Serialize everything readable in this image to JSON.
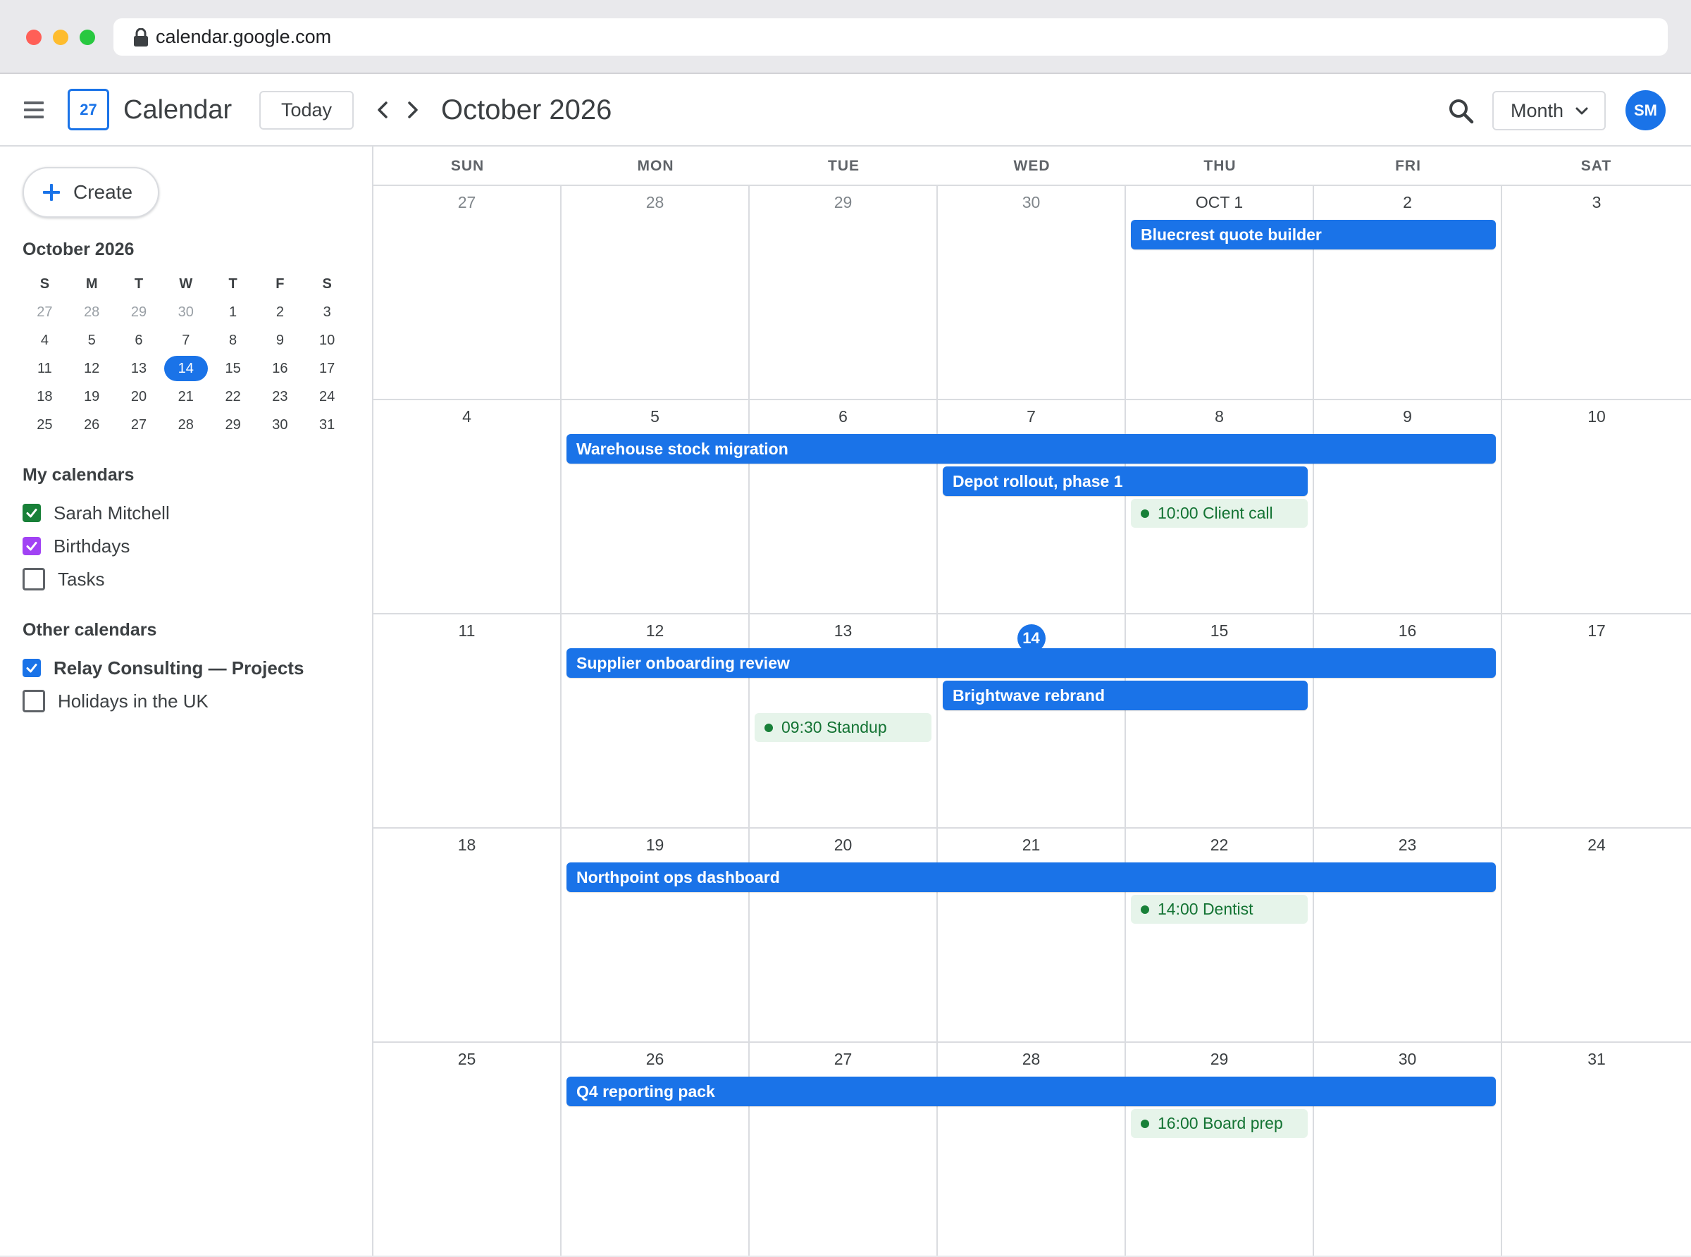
{
  "browser": {
    "url": "calendar.google.com"
  },
  "header": {
    "app_name": "Calendar",
    "logo_day": "27",
    "today_label": "Today",
    "month_title": "October 2026",
    "view_label": "Month",
    "avatar_initials": "SM"
  },
  "sidebar": {
    "create_label": "Create",
    "mini_title": "October 2026",
    "mini_weekdays": [
      "S",
      "M",
      "T",
      "W",
      "T",
      "F",
      "S"
    ],
    "mini_weeks": [
      [
        "27",
        "28",
        "29",
        "30",
        "1",
        "2",
        "3"
      ],
      [
        "4",
        "5",
        "6",
        "7",
        "8",
        "9",
        "10"
      ],
      [
        "11",
        "12",
        "13",
        "14",
        "15",
        "16",
        "17"
      ],
      [
        "18",
        "19",
        "20",
        "21",
        "22",
        "23",
        "24"
      ],
      [
        "25",
        "26",
        "27",
        "28",
        "29",
        "30",
        "31"
      ]
    ],
    "mini_selected": "14",
    "my_calendars_title": "My calendars",
    "my_calendars": [
      {
        "label": "Sarah Mitchell",
        "checked": true,
        "color": "#188038"
      },
      {
        "label": "Birthdays",
        "checked": true,
        "color": "#a142f4"
      },
      {
        "label": "Tasks",
        "checked": false,
        "color": "#5f6368"
      }
    ],
    "other_calendars_title": "Other calendars",
    "other_calendars": [
      {
        "label": "Relay Consulting — Projects",
        "checked": true,
        "color": "#1a73e8"
      },
      {
        "label": "Holidays in the UK",
        "checked": false,
        "color": "#5f6368"
      }
    ]
  },
  "grid": {
    "weekdays": [
      "SUN",
      "MON",
      "TUE",
      "WED",
      "THU",
      "FRI",
      "SAT"
    ],
    "weeks": [
      {
        "days": [
          "27",
          "28",
          "29",
          "30",
          "OCT 1",
          "2",
          "3"
        ],
        "muted": [
          0,
          1,
          2,
          3
        ]
      },
      {
        "days": [
          "4",
          "5",
          "6",
          "7",
          "8",
          "9",
          "10"
        ],
        "muted": []
      },
      {
        "days": [
          "11",
          "12",
          "13",
          "14",
          "15",
          "16",
          "17"
        ],
        "muted": [],
        "today": 3
      },
      {
        "days": [
          "18",
          "19",
          "20",
          "21",
          "22",
          "23",
          "24"
        ],
        "muted": []
      },
      {
        "days": [
          "25",
          "26",
          "27",
          "28",
          "29",
          "30",
          "31"
        ],
        "muted": []
      }
    ],
    "events": [
      {
        "title": "Bluecrest quote builder",
        "week": 0,
        "start": 4,
        "end": 5,
        "slot": 0,
        "kind": "bar"
      },
      {
        "title": "Warehouse stock migration",
        "week": 1,
        "start": 1,
        "end": 5,
        "slot": 0,
        "kind": "bar"
      },
      {
        "title": "Depot rollout, phase 1",
        "week": 1,
        "start": 3,
        "end": 4,
        "slot": 1,
        "kind": "bar"
      },
      {
        "title": "10:00 Client call",
        "week": 1,
        "start": 4,
        "end": 4,
        "slot": 2,
        "kind": "chip"
      },
      {
        "title": "Supplier onboarding review",
        "week": 2,
        "start": 1,
        "end": 5,
        "slot": 0,
        "kind": "bar"
      },
      {
        "title": "Brightwave rebrand",
        "week": 2,
        "start": 3,
        "end": 4,
        "slot": 1,
        "kind": "bar"
      },
      {
        "title": "09:30 Standup",
        "week": 2,
        "start": 2,
        "end": 2,
        "slot": 2,
        "kind": "chip"
      },
      {
        "title": "Northpoint ops dashboard",
        "week": 3,
        "start": 1,
        "end": 5,
        "slot": 0,
        "kind": "bar"
      },
      {
        "title": "14:00 Dentist",
        "week": 3,
        "start": 4,
        "end": 4,
        "slot": 1,
        "kind": "chip"
      },
      {
        "title": "Q4 reporting pack",
        "week": 4,
        "start": 1,
        "end": 5,
        "slot": 0,
        "kind": "bar"
      },
      {
        "title": "16:00 Board prep",
        "week": 4,
        "start": 4,
        "end": 4,
        "slot": 1,
        "kind": "chip"
      }
    ]
  },
  "colors": {
    "accent": "#1a73e8",
    "chip_bg": "#e6f4ea",
    "chip_text": "#137333"
  },
  "icons": [
    "lock-icon",
    "menu-icon",
    "chevron-left-icon",
    "chevron-right-icon",
    "search-icon",
    "chevron-down-icon",
    "plus-icon",
    "check-icon"
  ]
}
